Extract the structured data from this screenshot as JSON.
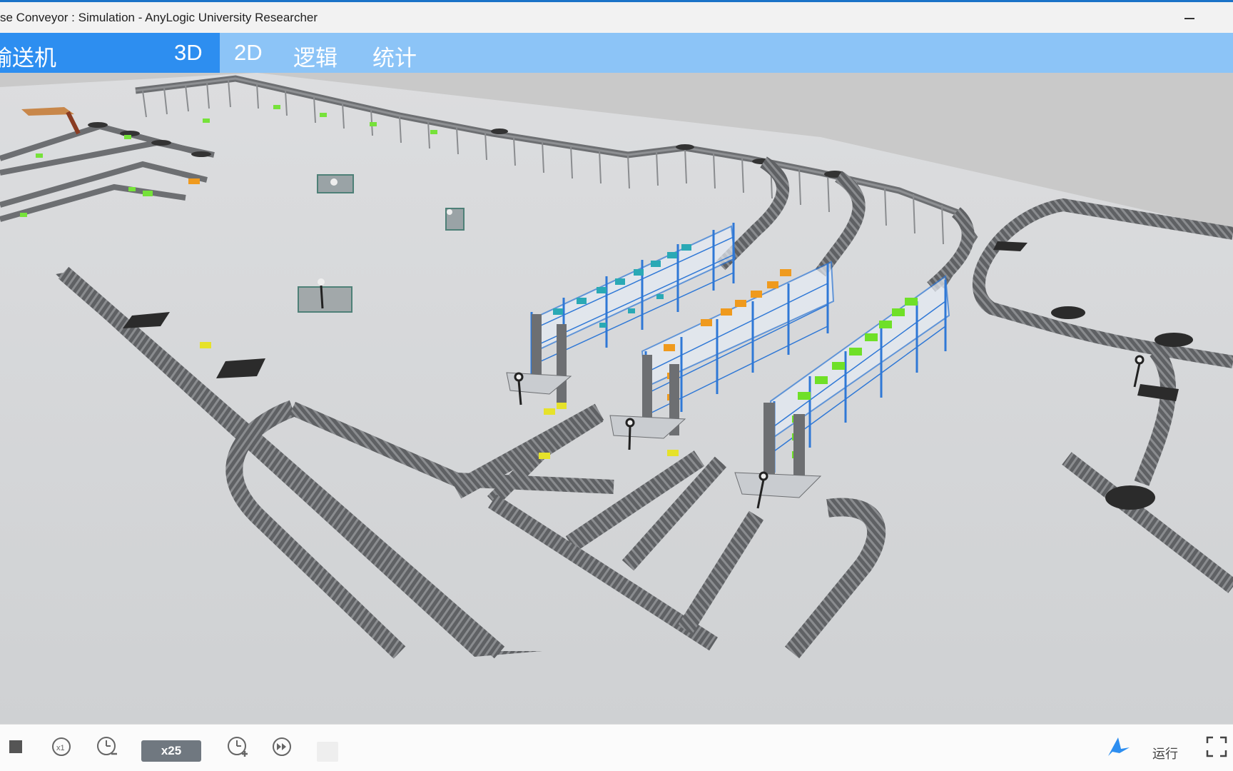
{
  "window": {
    "title": "se Conveyor : Simulation - AnyLogic University Researcher"
  },
  "tabs": [
    {
      "label": "输送机"
    },
    {
      "label": "3D"
    },
    {
      "label": "2D"
    },
    {
      "label": "逻辑"
    },
    {
      "label": "统计"
    }
  ],
  "controls": {
    "speed": "x25",
    "run_label": "运行",
    "icons": [
      "stop-icon",
      "x1-speed-icon",
      "slow-down-icon",
      "speed-up-icon",
      "fast-forward-icon",
      "anylogic-logo-icon",
      "fullscreen-icon"
    ]
  },
  "colors": {
    "tab_active": "#2d8ef0",
    "tab_bar": "#8cc4f7",
    "conveyor": "#6d6f72",
    "rack_blue": "#2f78d6",
    "box_teal": "#2aa9b5",
    "box_orange": "#ef9a1e",
    "box_green": "#6fe028",
    "box_yellow": "#e6e22a"
  }
}
